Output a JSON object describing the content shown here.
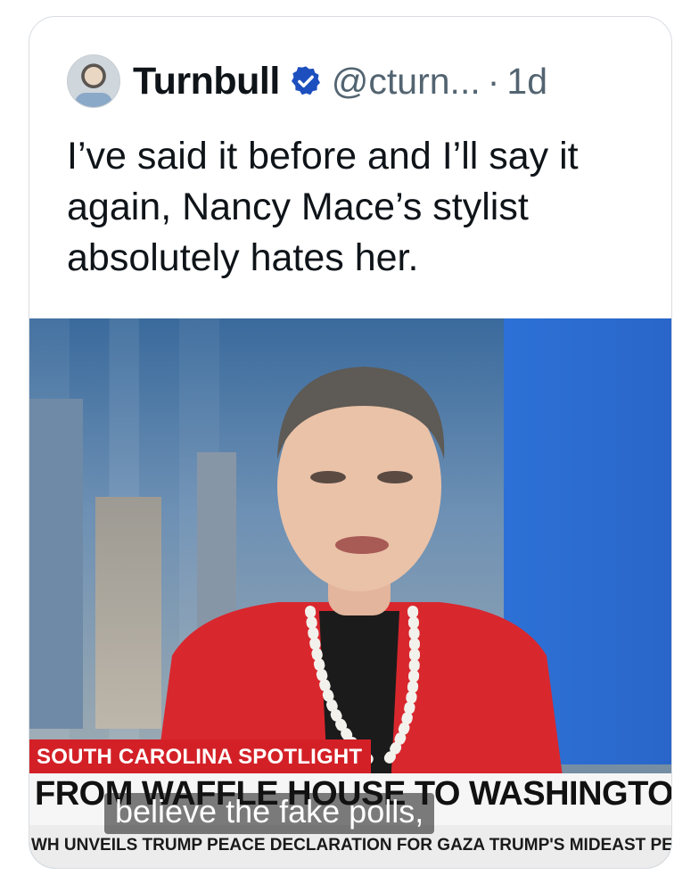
{
  "tweet": {
    "author_name": "Turnbull",
    "handle": "@cturn...",
    "separator": "·",
    "time": "1d",
    "text": "I’ve said it before and I’ll say it again, Nancy Mace’s stylist absolutely hates her.",
    "verified_icon": "verified-badge-icon",
    "verified_color": "#1d9bf0"
  },
  "media": {
    "lower_third_label": "SOUTH CAROLINA SPOTLIGHT",
    "headline": "FROM WAFFLE HOUSE TO WASHINGTO",
    "ticker": "WH UNVEILS TRUMP PEACE DECLARATION FOR GAZA   TRUMP'S MIDEAST PEA",
    "caption": "believe the fake polls,",
    "accent_red": "#d32027",
    "wall_blue": "#2d71d6"
  }
}
